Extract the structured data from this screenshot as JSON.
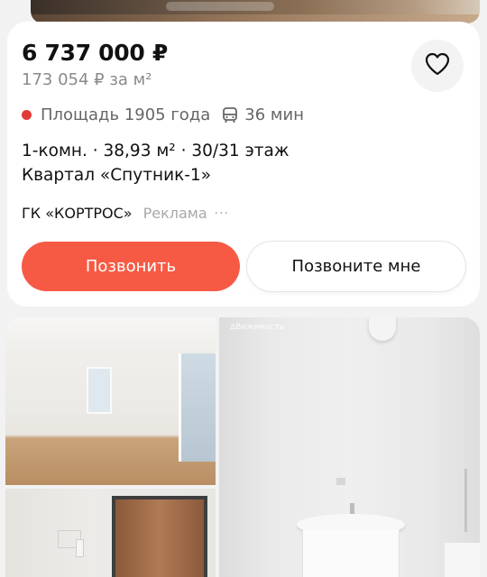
{
  "listing": {
    "price": "6 737 000 ₽",
    "price_per_m2": "173 054 ₽ за м²",
    "metro_color": "#e03b36",
    "metro_station": "Площадь 1905 года",
    "transport_icon": "bus-icon",
    "travel_time": "36 мин",
    "details_line": "1-комн. · 38,93 м² · 30/31 этаж",
    "complex_name": "Квартал «Спутник-1»",
    "developer": "ГК «КОРТРОС»",
    "ad_label": "Реклама",
    "more_label": "···",
    "favorite_icon": "heart-outline-icon"
  },
  "actions": {
    "call_label": "Позвонить",
    "callback_label": "Позвоните мне",
    "call_color": "#f65a44"
  },
  "photos": {
    "watermark": "дВижимость"
  }
}
